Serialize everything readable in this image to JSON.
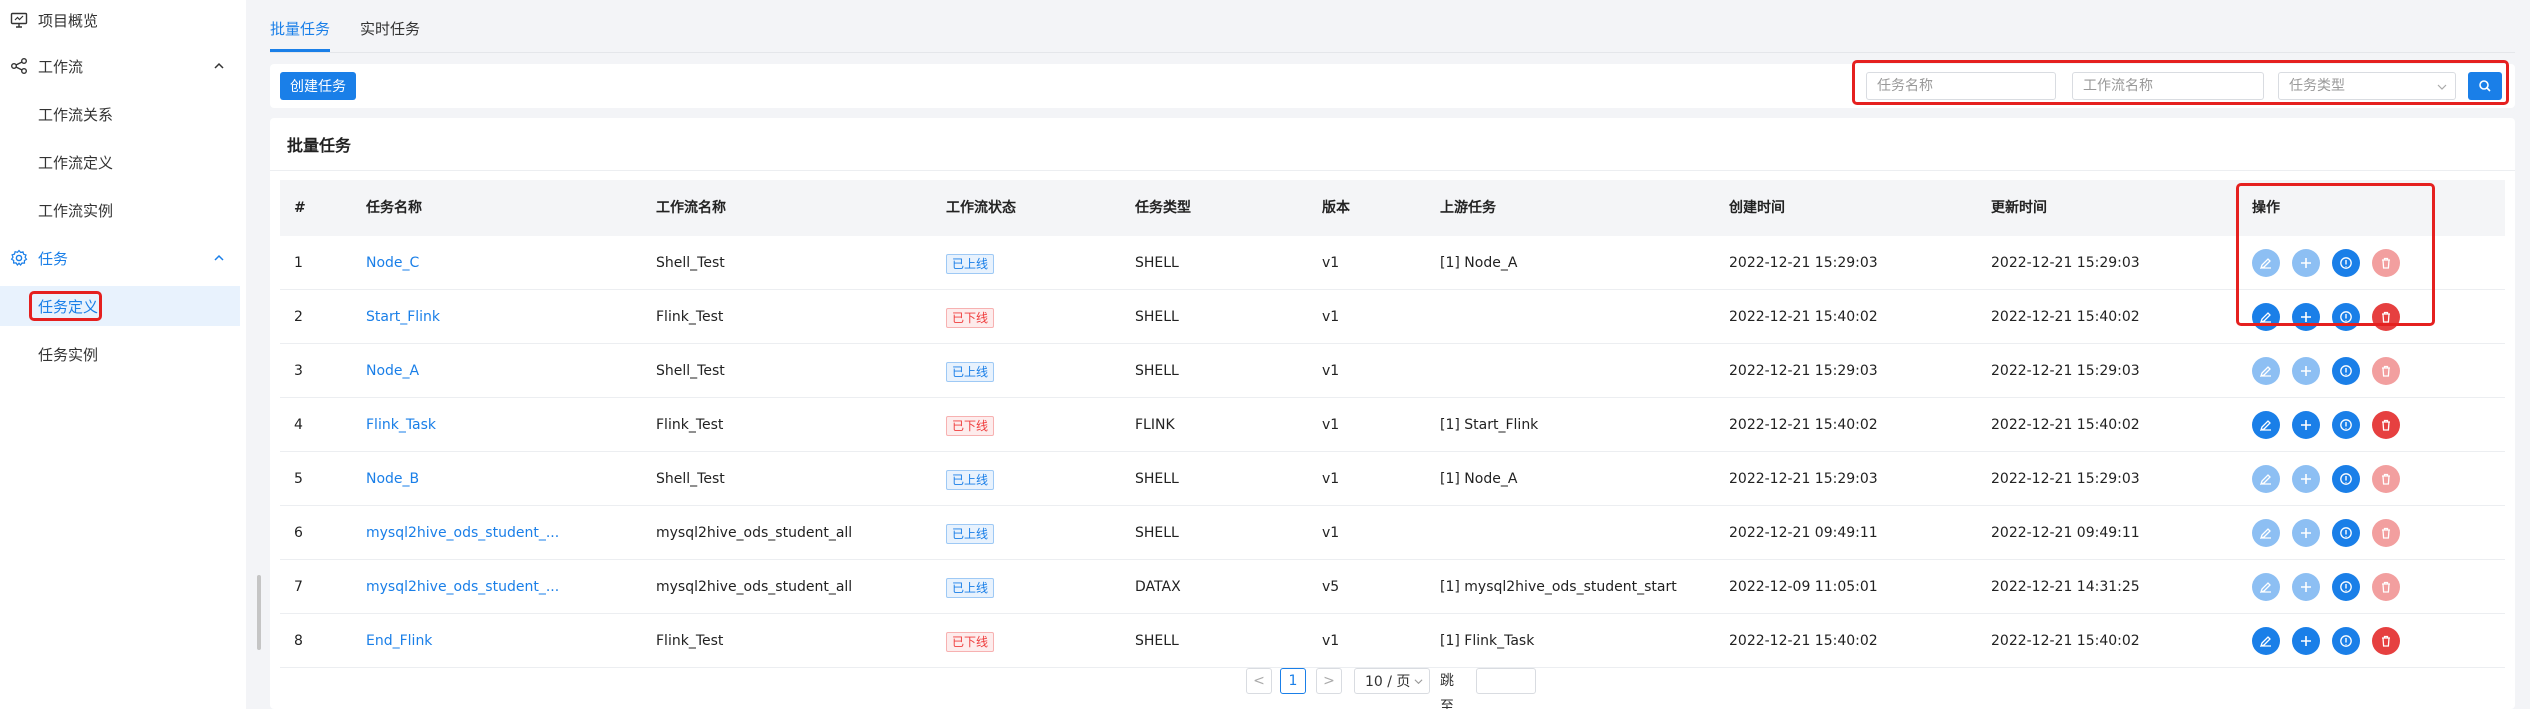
{
  "sidebar": {
    "items": [
      {
        "label": "项目概览",
        "icon": "monitor-icon"
      },
      {
        "label": "工作流",
        "icon": "workflow-icon"
      },
      {
        "label": "工作流关系"
      },
      {
        "label": "工作流定义"
      },
      {
        "label": "工作流实例"
      },
      {
        "label": "任务",
        "icon": "gear-icon"
      },
      {
        "label": "任务定义"
      },
      {
        "label": "任务实例"
      }
    ]
  },
  "tabs": [
    "批量任务",
    "实时任务"
  ],
  "toolbar": {
    "create_label": "创建任务",
    "task_name_placeholder": "任务名称",
    "workflow_name_placeholder": "工作流名称",
    "task_type_placeholder": "任务类型"
  },
  "panel": {
    "title": "批量任务",
    "columns": [
      "#",
      "任务名称",
      "工作流名称",
      "工作流状态",
      "任务类型",
      "版本",
      "上游任务",
      "创建时间",
      "更新时间",
      "操作"
    ],
    "rows": [
      {
        "no": "1",
        "name": "Node_C",
        "workflow": "Shell_Test",
        "status": "已上线",
        "type": "SHELL",
        "version": "v1",
        "upstream": "[1] Node_A",
        "created": "2022-12-21 15:29:03",
        "updated": "2022-12-21 15:29:03"
      },
      {
        "no": "2",
        "name": "Start_Flink",
        "workflow": "Flink_Test",
        "status": "已下线",
        "type": "SHELL",
        "version": "v1",
        "upstream": "",
        "created": "2022-12-21 15:40:02",
        "updated": "2022-12-21 15:40:02"
      },
      {
        "no": "3",
        "name": "Node_A",
        "workflow": "Shell_Test",
        "status": "已上线",
        "type": "SHELL",
        "version": "v1",
        "upstream": "",
        "created": "2022-12-21 15:29:03",
        "updated": "2022-12-21 15:29:03"
      },
      {
        "no": "4",
        "name": "Flink_Task",
        "workflow": "Flink_Test",
        "status": "已下线",
        "type": "FLINK",
        "version": "v1",
        "upstream": "[1] Start_Flink",
        "created": "2022-12-21 15:40:02",
        "updated": "2022-12-21 15:40:02"
      },
      {
        "no": "5",
        "name": "Node_B",
        "workflow": "Shell_Test",
        "status": "已上线",
        "type": "SHELL",
        "version": "v1",
        "upstream": "[1] Node_A",
        "created": "2022-12-21 15:29:03",
        "updated": "2022-12-21 15:29:03"
      },
      {
        "no": "6",
        "name": "mysql2hive_ods_student_...",
        "workflow": "mysql2hive_ods_student_all",
        "status": "已上线",
        "type": "SHELL",
        "version": "v1",
        "upstream": "",
        "created": "2022-12-21 09:49:11",
        "updated": "2022-12-21 09:49:11"
      },
      {
        "no": "7",
        "name": "mysql2hive_ods_student_...",
        "workflow": "mysql2hive_ods_student_all",
        "status": "已上线",
        "type": "DATAX",
        "version": "v5",
        "upstream": "[1] mysql2hive_ods_student_start",
        "created": "2022-12-09 11:05:01",
        "updated": "2022-12-21 14:31:25"
      },
      {
        "no": "8",
        "name": "End_Flink",
        "workflow": "Flink_Test",
        "status": "已下线",
        "type": "SHELL",
        "version": "v1",
        "upstream": "[1] Flink_Task",
        "created": "2022-12-21 15:40:02",
        "updated": "2022-12-21 15:40:02"
      }
    ]
  },
  "pagination": {
    "prev": "<",
    "current": "1",
    "next": ">",
    "page_size": "10 / 页",
    "jump_label": "跳至"
  },
  "colors": {
    "accent": "#1a7fe8",
    "danger": "#e64040",
    "highlight": "#e5201f"
  }
}
